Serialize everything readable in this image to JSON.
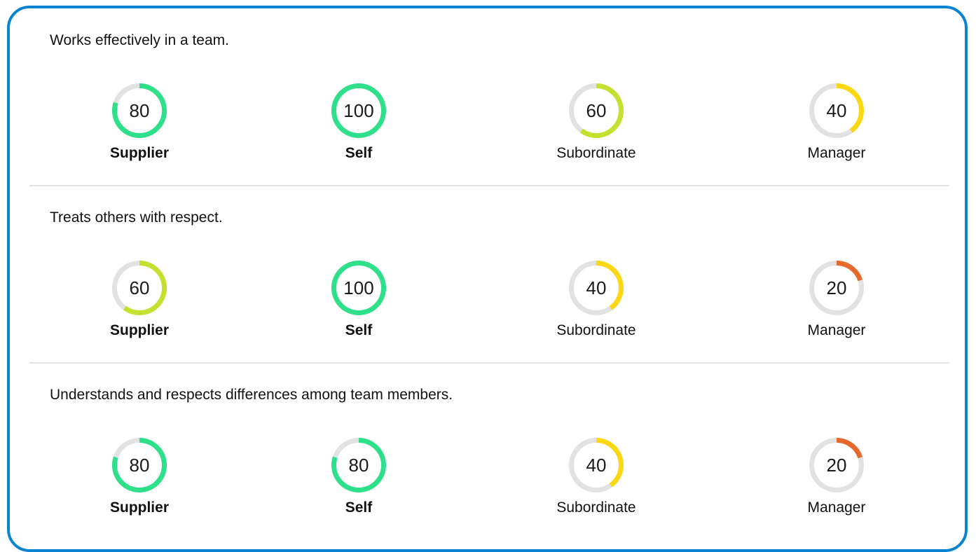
{
  "colors": {
    "frame": "#0a84d0",
    "track": "#e2e2e2",
    "green": "#2ee08a",
    "lime": "#c3e12e",
    "yellow": "#fbd813",
    "orange": "#e56a2c"
  },
  "sections": [
    {
      "title": "Works effectively in a team.",
      "metrics": [
        {
          "label": "Supplier",
          "value": "80",
          "score": 80,
          "color": "#2ee08a",
          "bold": true
        },
        {
          "label": "Self",
          "value": "100",
          "score": 100,
          "color": "#2ee08a",
          "bold": true
        },
        {
          "label": "Subordinate",
          "value": "60",
          "score": 60,
          "color": "#c3e12e",
          "bold": false
        },
        {
          "label": "Manager",
          "value": "40",
          "score": 40,
          "color": "#fbd813",
          "bold": false
        }
      ]
    },
    {
      "title": "Treats others with respect.",
      "metrics": [
        {
          "label": "Supplier",
          "value": "60",
          "score": 60,
          "color": "#c3e12e",
          "bold": true
        },
        {
          "label": "Self",
          "value": "100",
          "score": 100,
          "color": "#2ee08a",
          "bold": true
        },
        {
          "label": "Subordinate",
          "value": "40",
          "score": 40,
          "color": "#fbd813",
          "bold": false
        },
        {
          "label": "Manager",
          "value": "20",
          "score": 20,
          "color": "#e56a2c",
          "bold": false
        }
      ]
    },
    {
      "title": "Understands and respects differences among team members.",
      "metrics": [
        {
          "label": "Supplier",
          "value": "80",
          "score": 80,
          "color": "#2ee08a",
          "bold": true
        },
        {
          "label": "Self",
          "value": "80",
          "score": 80,
          "color": "#2ee08a",
          "bold": true
        },
        {
          "label": "Subordinate",
          "value": "40",
          "score": 40,
          "color": "#fbd813",
          "bold": false
        },
        {
          "label": "Manager",
          "value": "20",
          "score": 20,
          "color": "#e56a2c",
          "bold": false
        }
      ]
    }
  ]
}
